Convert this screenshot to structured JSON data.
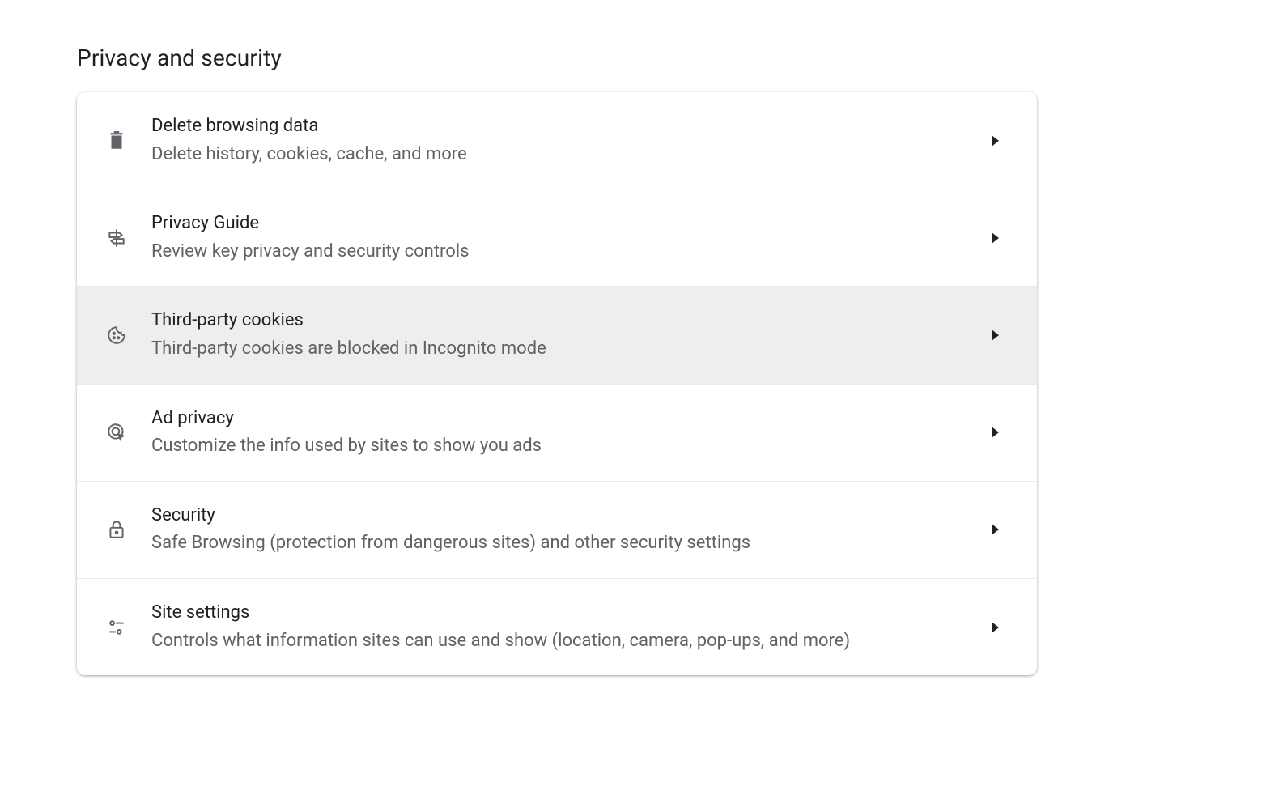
{
  "section": {
    "title": "Privacy and security"
  },
  "rows": [
    {
      "title": "Delete browsing data",
      "subtitle": "Delete history, cookies, cache, and more"
    },
    {
      "title": "Privacy Guide",
      "subtitle": "Review key privacy and security controls"
    },
    {
      "title": "Third-party cookies",
      "subtitle": "Third-party cookies are blocked in Incognito mode"
    },
    {
      "title": "Ad privacy",
      "subtitle": "Customize the info used by sites to show you ads"
    },
    {
      "title": "Security",
      "subtitle": "Safe Browsing (protection from dangerous sites) and other security settings"
    },
    {
      "title": "Site settings",
      "subtitle": "Controls what information sites can use and show (location, camera, pop-ups, and more)"
    }
  ]
}
